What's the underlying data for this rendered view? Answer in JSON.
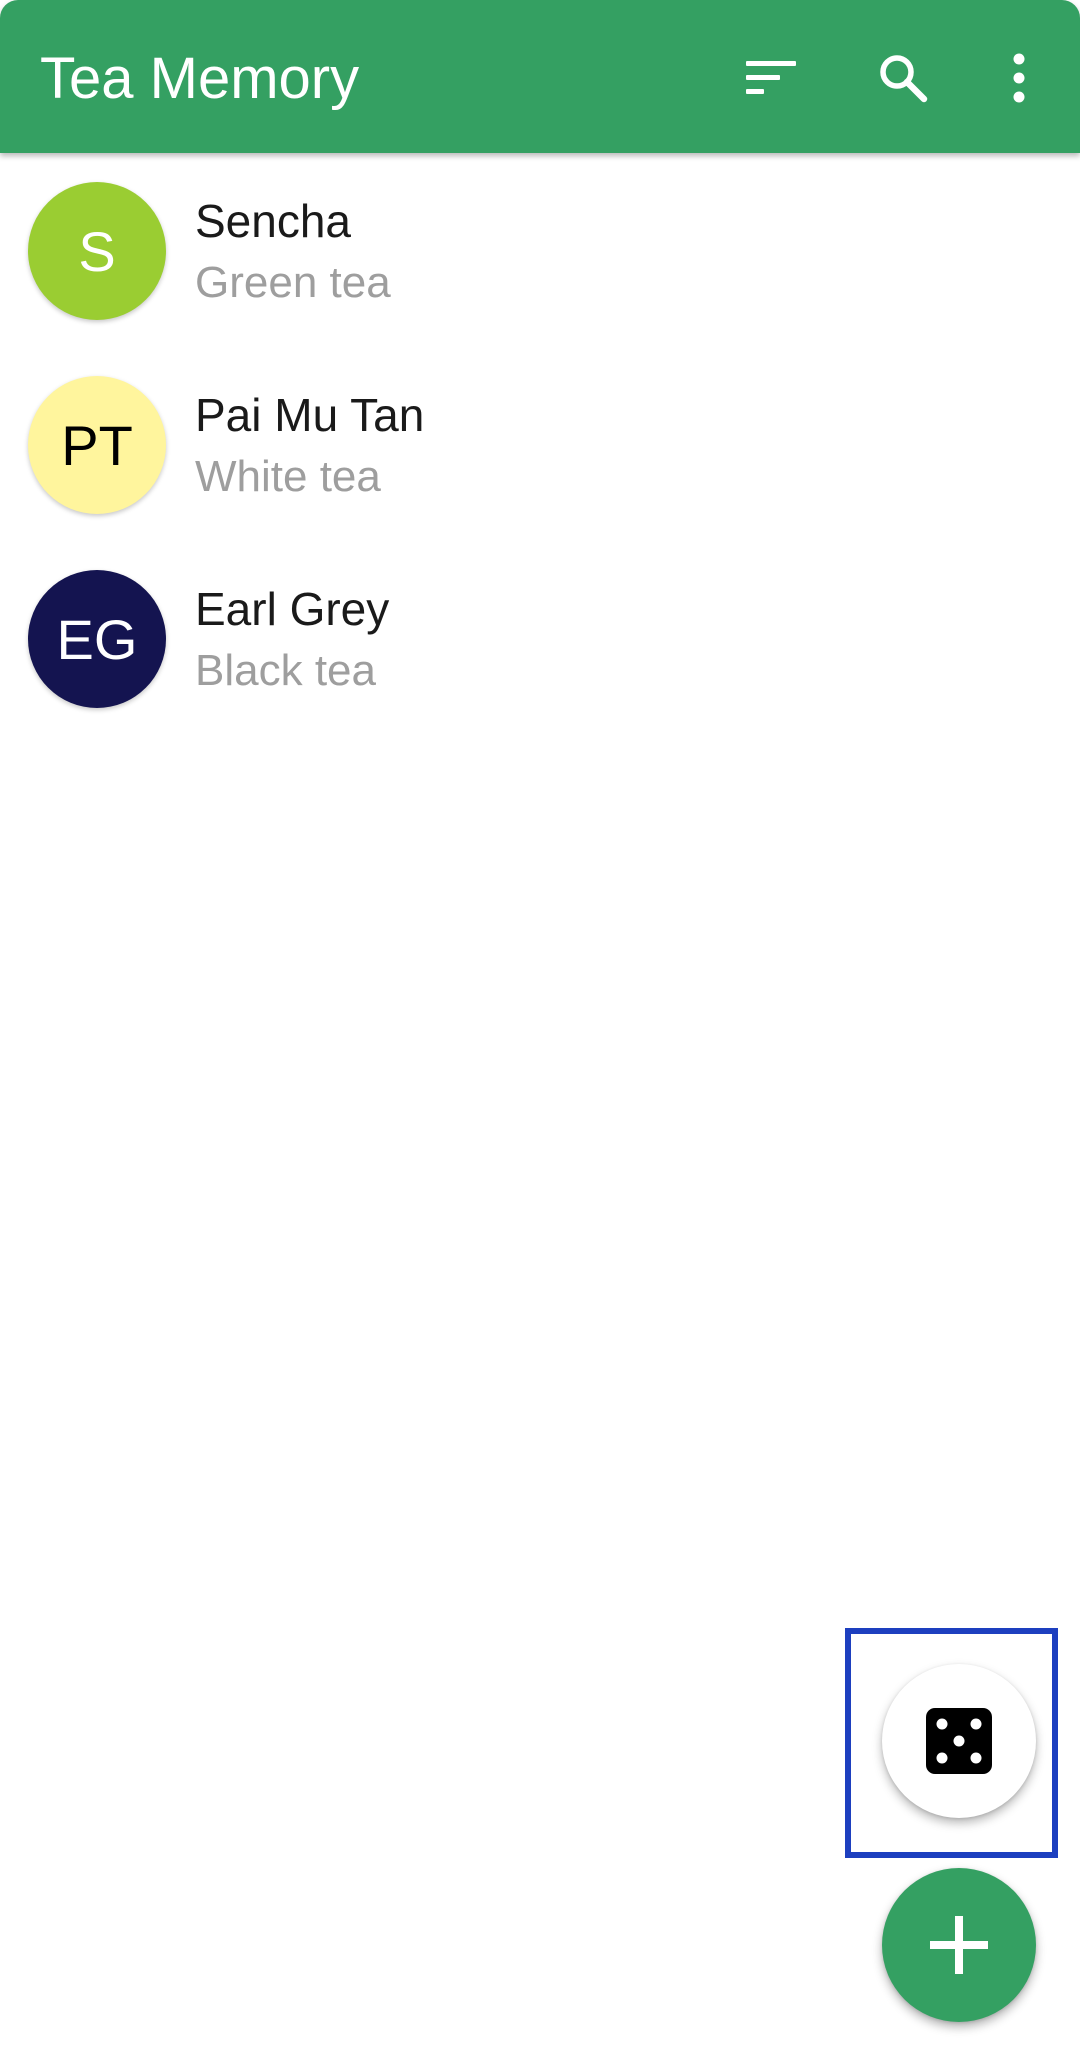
{
  "appbar": {
    "title": "Tea Memory",
    "background_color": "#34a062",
    "actions": [
      {
        "icon": "sort-icon"
      },
      {
        "icon": "search-icon"
      },
      {
        "icon": "more-vert-icon"
      }
    ]
  },
  "teas": [
    {
      "initials": "S",
      "name": "Sencha",
      "type": "Green tea",
      "avatar_color": "#9acd32",
      "avatar_text_color": "#ffffff"
    },
    {
      "initials": "PT",
      "name": "Pai Mu Tan",
      "type": "White tea",
      "avatar_color": "#fff59d",
      "avatar_text_color": "#000000"
    },
    {
      "initials": "EG",
      "name": "Earl Grey",
      "type": "Black tea",
      "avatar_color": "#141450",
      "avatar_text_color": "#ffffff"
    }
  ],
  "fabs": {
    "random": {
      "icon": "dice-icon",
      "background_color": "#ffffff"
    },
    "add": {
      "icon": "plus-icon",
      "background_color": "#34a062"
    }
  },
  "highlight": {
    "color": "#1d3fbf"
  }
}
